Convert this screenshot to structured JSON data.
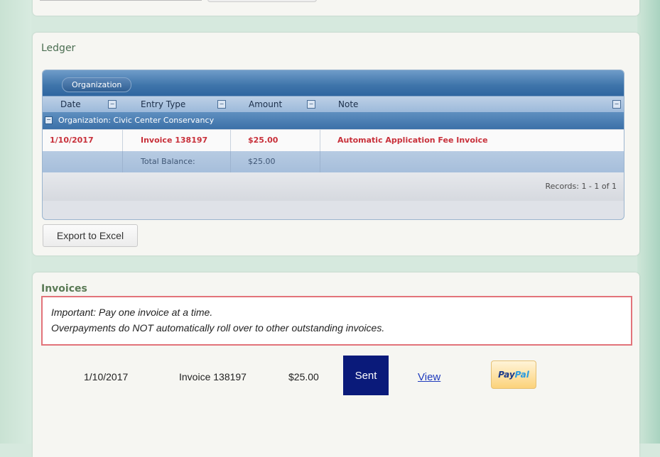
{
  "ledger": {
    "title": "Ledger",
    "group_chip": "Organization",
    "columns": [
      "Date",
      "Entry Type",
      "Amount",
      "Note"
    ],
    "group_label": "Organization: Civic Center Conservancy",
    "rows": [
      {
        "date": "1/10/2017",
        "entry_type": "Invoice 138197",
        "amount": "$25.00",
        "note": "Automatic Application Fee Invoice"
      }
    ],
    "total": {
      "label": "Total Balance:",
      "amount": "$25.00"
    },
    "records": "Records: 1 - 1 of 1",
    "export_label": "Export to Excel"
  },
  "invoices": {
    "title": "Invoices",
    "notice_line1": "Important: Pay one invoice at a time.",
    "notice_line2": "Overpayments do NOT automatically roll over to other outstanding invoices.",
    "items": [
      {
        "date": "1/10/2017",
        "invoice": "Invoice 138197",
        "amount": "$25.00",
        "status": "Sent",
        "view_label": "View",
        "pay_logo_1": "Pay",
        "pay_logo_2": "Pal"
      }
    ]
  },
  "colors": {
    "accent_blue": "#3e74aa",
    "ledger_text": "#c8303a",
    "sent_bg": "#0a1a7a",
    "notice_border": "#e2737a"
  }
}
